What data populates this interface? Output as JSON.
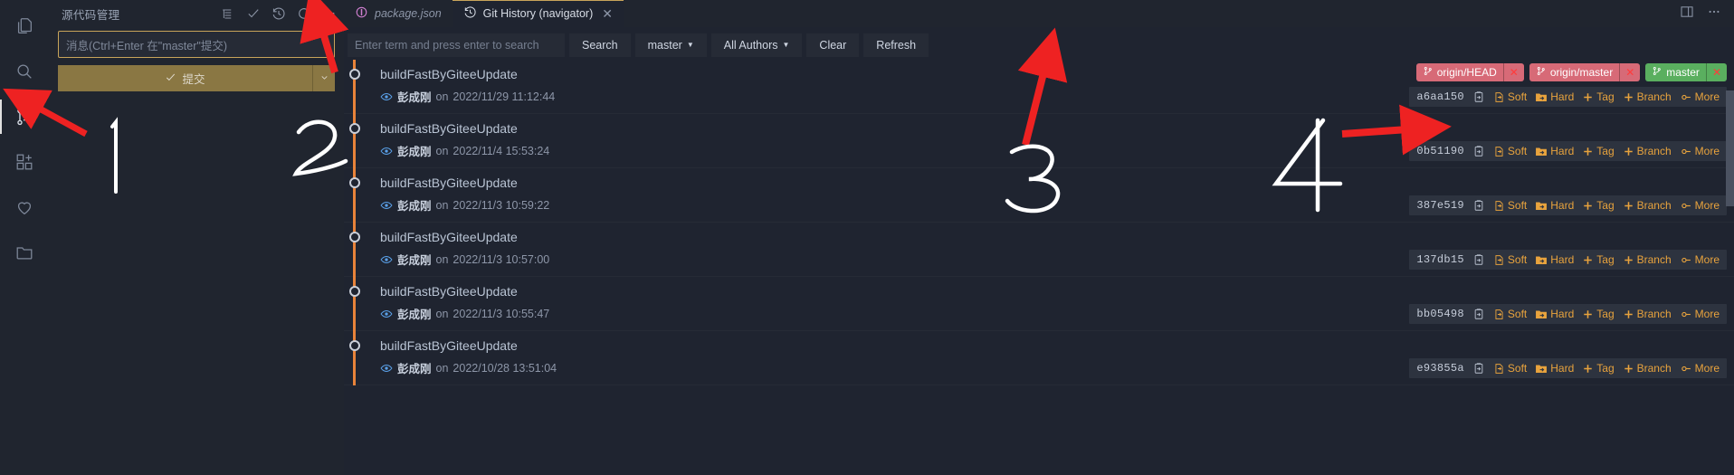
{
  "window": {
    "theme_bg": "#1f2430",
    "panel_bg": "#20252f",
    "accent_orange": "#e8a33d",
    "graph_color": "#e8833a",
    "ref_red": "#d76a77",
    "ref_green": "#5aaf5f"
  },
  "activity_bar": {
    "items": [
      {
        "name": "explorer",
        "icon": "files-icon",
        "active": false
      },
      {
        "name": "search",
        "icon": "search-icon",
        "active": false
      },
      {
        "name": "source-control",
        "icon": "source-control-icon",
        "active": true
      },
      {
        "name": "extensions",
        "icon": "extensions-icon",
        "active": false
      },
      {
        "name": "favorites",
        "icon": "heart-icon",
        "active": false
      },
      {
        "name": "workspace",
        "icon": "folder-icon",
        "active": false
      }
    ]
  },
  "scm": {
    "title": "源代码管理",
    "actions": [
      {
        "name": "view-as-list",
        "icon": "list-icon"
      },
      {
        "name": "commit",
        "icon": "check-icon"
      },
      {
        "name": "git-history",
        "icon": "history-icon"
      },
      {
        "name": "refresh",
        "icon": "refresh-icon"
      },
      {
        "name": "more-actions",
        "icon": "ellipsis-icon"
      }
    ],
    "message_input": {
      "value": "",
      "placeholder": "消息(Ctrl+Enter 在\"master\"提交)"
    },
    "commit_button": {
      "label": "提交",
      "icon": "check-icon",
      "dropdown_icon": "chevron-down-icon"
    }
  },
  "tabs": {
    "items": [
      {
        "label": "package.json",
        "icon": "json-icon",
        "active": false,
        "preview": true,
        "closable": false
      },
      {
        "label": "Git History (navigator)",
        "icon": "history-icon",
        "active": true,
        "preview": false,
        "closable": true
      }
    ],
    "close_glyph": "✕",
    "right_actions": [
      {
        "name": "split-editor",
        "icon": "split-editor-icon"
      },
      {
        "name": "more-editor-actions",
        "icon": "ellipsis-icon"
      }
    ]
  },
  "git_history": {
    "search": {
      "value": "",
      "placeholder": "Enter term and press enter to search"
    },
    "buttons": [
      {
        "name": "search-button",
        "label": "Search",
        "has_caret": false
      },
      {
        "name": "branch-selector",
        "label": "master",
        "has_caret": true
      },
      {
        "name": "author-selector",
        "label": "All Authors",
        "has_caret": true
      },
      {
        "name": "clear-button",
        "label": "Clear",
        "has_caret": false
      },
      {
        "name": "refresh-button",
        "label": "Refresh",
        "has_caret": false
      }
    ],
    "action_labels": {
      "copy": "copy-hash-icon",
      "soft": "Soft",
      "hard": "Hard",
      "tag": "Tag",
      "branch": "Branch",
      "more": "More"
    },
    "commits": [
      {
        "subject": "buildFastByGiteeUpdate",
        "author": "彭成刚",
        "date_prefix": "on",
        "date": "2022/11/29 11:12:44",
        "hash": "a6aa150",
        "refs": [
          {
            "label": "origin/HEAD",
            "color": "red"
          },
          {
            "label": "origin/master",
            "color": "red"
          },
          {
            "label": "master",
            "color": "green"
          }
        ]
      },
      {
        "subject": "buildFastByGiteeUpdate",
        "author": "彭成刚",
        "date_prefix": "on",
        "date": "2022/11/4 15:53:24",
        "hash": "0b51190",
        "refs": []
      },
      {
        "subject": "buildFastByGiteeUpdate",
        "author": "彭成刚",
        "date_prefix": "on",
        "date": "2022/11/3 10:59:22",
        "hash": "387e519",
        "refs": []
      },
      {
        "subject": "buildFastByGiteeUpdate",
        "author": "彭成刚",
        "date_prefix": "on",
        "date": "2022/11/3 10:57:00",
        "hash": "137db15",
        "refs": []
      },
      {
        "subject": "buildFastByGiteeUpdate",
        "author": "彭成刚",
        "date_prefix": "on",
        "date": "2022/11/3 10:55:47",
        "hash": "bb05498",
        "refs": []
      },
      {
        "subject": "buildFastByGiteeUpdate",
        "author": "彭成刚",
        "date_prefix": "on",
        "date": "2022/10/28 13:51:04",
        "hash": "e93855a",
        "refs": []
      }
    ]
  },
  "annotations": {
    "color": "#ee2222",
    "numeral_color": "#ffffff",
    "items": [
      {
        "name": "annotation-1",
        "numeral": "1",
        "points_to": "source-control-activity-icon"
      },
      {
        "name": "annotation-2",
        "numeral": "2",
        "points_to": "git-history-scm-icon"
      },
      {
        "name": "annotation-3",
        "numeral": "3",
        "points_to": "refresh-button"
      },
      {
        "name": "annotation-4",
        "numeral": "4",
        "points_to": "commit-action-row"
      }
    ]
  }
}
